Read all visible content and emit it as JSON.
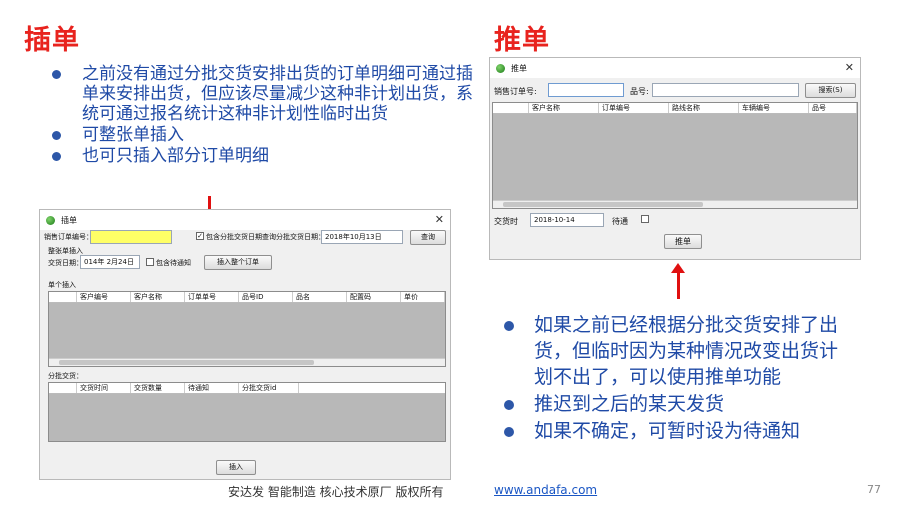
{
  "left": {
    "title": "插单",
    "bullets": [
      "之前没有通过分批交货安排出货的订单明细可通过插单来安排出货，但应该尽量减少这种非计划出货，系统可通过报名统计这种非计划性临时出货",
      "可整张单插入",
      "也可只插入部分订单明细"
    ]
  },
  "right": {
    "title": "推单",
    "bullets": [
      "如果之前已经根据分批交货安排了出货，但临时因为某种情况改变出货计划不出了，可以使用推单功能",
      "推迟到之后的某天发货",
      "如果不确定，可暂时设为待通知"
    ]
  },
  "insert_window": {
    "title": "插单",
    "order_no_label": "销售订单编号：",
    "order_no_value": "",
    "include_check_label": "包含分批交货日期查询",
    "batch_date_label": "分批交货日期：",
    "batch_date_value": "2018年10月13日",
    "query_button": "查询",
    "whole_group_label": "整张单插入",
    "delivery_date_label": "交货日期：",
    "delivery_date_value": "014年 2月24日",
    "include_pending_label": "包含待通知",
    "insert_whole_button": "插入整个订单",
    "single_group_label": "单个插入",
    "detail_columns": [
      "客户编号",
      "客户名称",
      "订单单号",
      "品号ID",
      "品名",
      "配置码",
      "单价"
    ],
    "batch_group_label": "分批交货：",
    "batch_columns": [
      "交货时间",
      "交货数量",
      "待通知",
      "分批交货id"
    ],
    "insert_button": "插入"
  },
  "push_window": {
    "title": "推单",
    "order_no_label": "销售订单号:",
    "order_no_value": "",
    "item_label": "品号:",
    "item_value": "",
    "search_button": "搜索(S)",
    "columns": [
      "客户名称",
      "订单编号",
      "路线名称",
      "车辆编号",
      "品号"
    ],
    "delivery_label": "交货时",
    "delivery_date_value": "2018-10-14",
    "pending_label": "待通",
    "push_button": "推单"
  },
  "footer": {
    "company_text": "安达发  智能制造 核心技术原厂  版权所有",
    "url": "www.andafa.com",
    "page_number": "77"
  },
  "colors": {
    "title_red": "#e8231e",
    "bullet_blue": "#1f4aa6",
    "arrow_red": "#e01010",
    "link_blue": "#1a56c4",
    "highlight_yellow": "#ffff66"
  }
}
